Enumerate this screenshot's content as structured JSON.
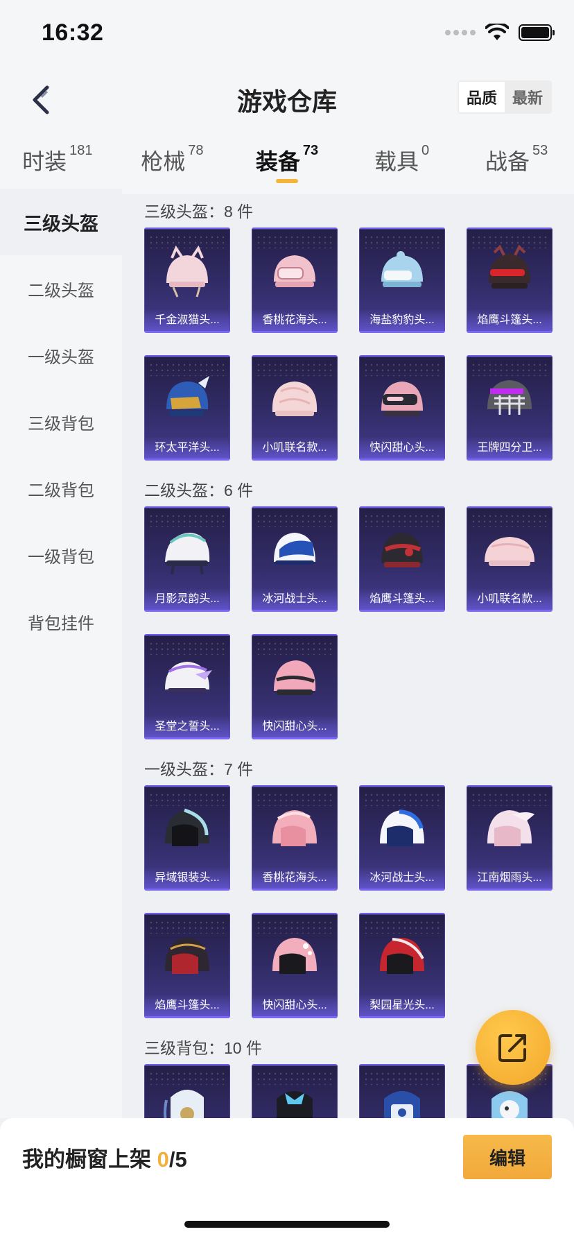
{
  "status": {
    "time": "16:32"
  },
  "header": {
    "title": "游戏仓库",
    "sort": {
      "quality": "品质",
      "newest": "最新"
    }
  },
  "tabs": [
    {
      "label": "时装",
      "count": "181"
    },
    {
      "label": "枪械",
      "count": "78"
    },
    {
      "label": "装备",
      "count": "73"
    },
    {
      "label": "载具",
      "count": "0"
    },
    {
      "label": "战备",
      "count": "53"
    }
  ],
  "sidebar": [
    "三级头盔",
    "二级头盔",
    "一级头盔",
    "三级背包",
    "二级背包",
    "一级背包",
    "背包挂件"
  ],
  "sections": [
    {
      "title": "三级头盔：8 件",
      "items": [
        "千金淑猫头...",
        "香桃花海头...",
        "海盐豹豹头...",
        "焰鹰斗篷头...",
        "环太平洋头...",
        "小叽联名款...",
        "快闪甜心头...",
        "王牌四分卫..."
      ]
    },
    {
      "title": "二级头盔：6 件",
      "items": [
        "月影灵韵头...",
        "冰河战士头...",
        "焰鹰斗篷头...",
        "小叽联名款...",
        "圣堂之誓头...",
        "快闪甜心头..."
      ]
    },
    {
      "title": "一级头盔：7 件",
      "items": [
        "异域银装头...",
        "香桃花海头...",
        "冰河战士头...",
        "江南烟雨头...",
        "焰鹰斗篷头...",
        "快闪甜心头...",
        "梨园星光头..."
      ]
    },
    {
      "title": "三级背包：10 件",
      "items": [
        "",
        "",
        "",
        ""
      ]
    }
  ],
  "bottom": {
    "showcase_label": "我的橱窗上架 ",
    "used": "0",
    "total": "/5",
    "edit": "编辑"
  },
  "colors": {
    "accent": "#f3b03a",
    "card_bg": "#2c2660",
    "card_border": "#7a68f2"
  }
}
